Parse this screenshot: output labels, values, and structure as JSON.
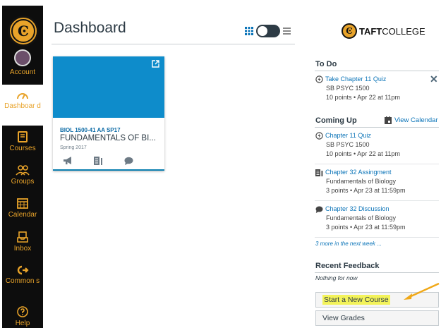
{
  "colors": {
    "accent": "#e8a32a",
    "nav_bg": "#0d0d0d",
    "card_hero": "#0e8ccb",
    "link": "#0b74b8",
    "highlight": "#f3f35a"
  },
  "nav": {
    "items": [
      {
        "label": "Account",
        "icon": "avatar-icon"
      },
      {
        "label": "Dashboar d",
        "icon": "dashboard-icon"
      },
      {
        "label": "Courses",
        "icon": "courses-icon"
      },
      {
        "label": "Groups",
        "icon": "groups-icon"
      },
      {
        "label": "Calendar",
        "icon": "calendar-icon"
      },
      {
        "label": "Inbox",
        "icon": "inbox-icon"
      },
      {
        "label": "Common s",
        "icon": "commons-icon"
      },
      {
        "label": "Help",
        "icon": "help-icon"
      }
    ]
  },
  "header": {
    "title": "Dashboard"
  },
  "card": {
    "code": "BIOL 1500-41 AA SP17",
    "name": "FUNDAMENTALS OF BI...",
    "term": "Spring 2017"
  },
  "brand": {
    "bold": "TAFT",
    "rest": "COLLEGE"
  },
  "todo": {
    "heading": "To Do",
    "item": {
      "title": "Take Chapter 11 Quiz",
      "course": "SB PSYC 1500",
      "meta": "10 points • Apr 22 at 11pm"
    }
  },
  "coming_up": {
    "heading": "Coming Up",
    "view_calendar": "View Calendar",
    "items": [
      {
        "title": "Chapter 11 Quiz",
        "course": "SB PSYC 1500",
        "meta": "10 points • Apr 22 at 11pm",
        "icon": "quiz-icon"
      },
      {
        "title": "Chapter 32 Assingment",
        "course": "Fundamentals of Biology",
        "meta": "3 points • Apr 23 at 11:59pm",
        "icon": "assignment-icon"
      },
      {
        "title": "Chapter 32 Discussion",
        "course": "Fundamentals of Biology",
        "meta": "3 points • Apr 23 at 11:59pm",
        "icon": "discussion-icon"
      }
    ],
    "more": "3 more in the next week ..."
  },
  "feedback": {
    "heading": "Recent Feedback",
    "empty": "Nothing for now"
  },
  "buttons": {
    "start_course": "Start a New Course",
    "view_grades": "View Grades"
  }
}
